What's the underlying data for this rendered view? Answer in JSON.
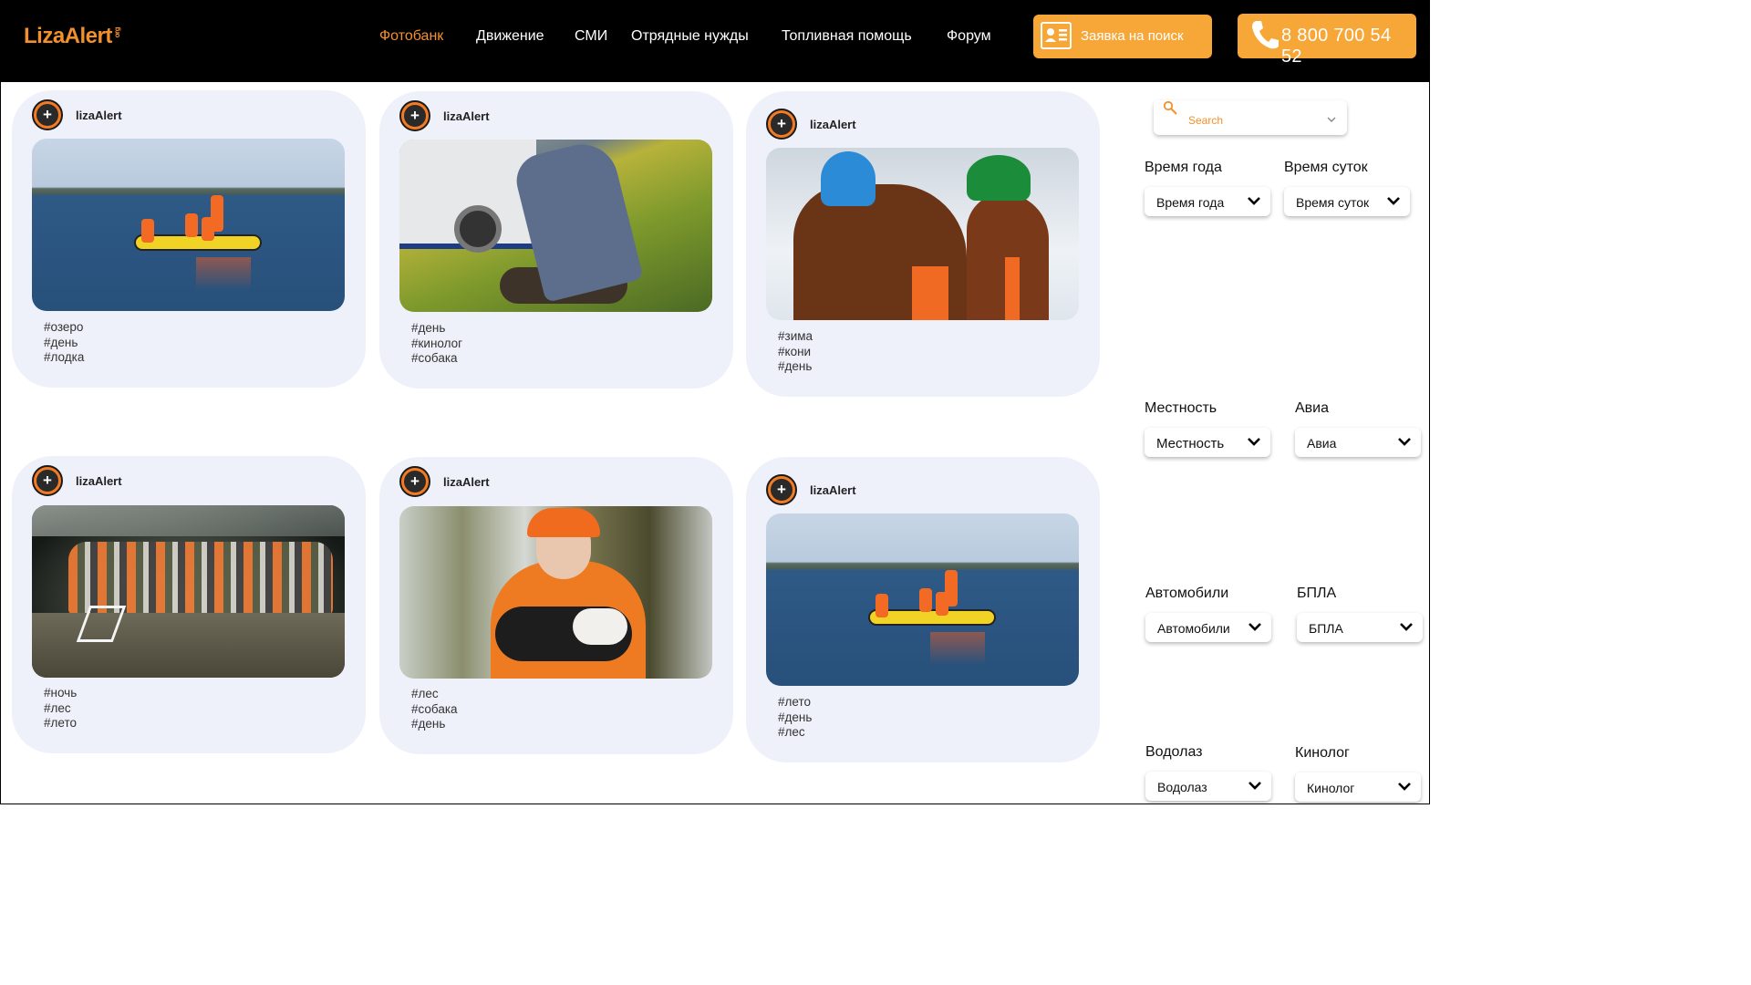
{
  "header": {
    "logo": "LizaAlert",
    "logo_suffix": "org",
    "nav": [
      "Фотобанк",
      "Движение",
      "СМИ",
      "Отрядные нужды",
      "Топливная помощь",
      "Форум"
    ],
    "active_nav": "Фотобанк",
    "request_button": "Заявка на поиск",
    "phone_button": "8 800 700 54 52"
  },
  "cards": [
    {
      "user": "lizaAlert",
      "image": "lake-boat-photo",
      "tags": [
        "#озеро",
        "#день",
        "#лодка"
      ]
    },
    {
      "user": "lizaAlert",
      "image": "dog-handler-photo",
      "tags": [
        "#день",
        "#кинолог",
        "#собака"
      ]
    },
    {
      "user": "lizaAlert",
      "image": "horses-winter-photo",
      "tags": [
        "#зима",
        "#кони",
        "#день"
      ]
    },
    {
      "user": "lizaAlert",
      "image": "night-group-photo",
      "tags": [
        "#ночь",
        "#лес",
        "#лето"
      ]
    },
    {
      "user": "lizaAlert",
      "image": "girl-puppy-photo",
      "tags": [
        "#лес",
        "#собака",
        "#день"
      ]
    },
    {
      "user": "lizaAlert",
      "image": "lake-boat-photo",
      "tags": [
        "#лето",
        "#день",
        "#лес"
      ]
    }
  ],
  "sidebar": {
    "search_placeholder": "Search",
    "filters": [
      {
        "label": "Время года",
        "value": "Время года"
      },
      {
        "label": "Время суток",
        "value": "Время суток"
      },
      {
        "label": "Местность",
        "value": "Местность"
      },
      {
        "label": "Авиа",
        "value": "Авиа"
      },
      {
        "label": "Автомобили",
        "value": "Автомобили"
      },
      {
        "label": "БПЛА",
        "value": "БПЛА"
      },
      {
        "label": "Водолаз",
        "value": "Водолаз"
      },
      {
        "label": "Кинолог",
        "value": "Кинолог"
      }
    ]
  },
  "colors": {
    "accent": "#f4902b",
    "button": "#f7a737",
    "card_bg": "#eef1fa",
    "header_bg": "#000000"
  }
}
